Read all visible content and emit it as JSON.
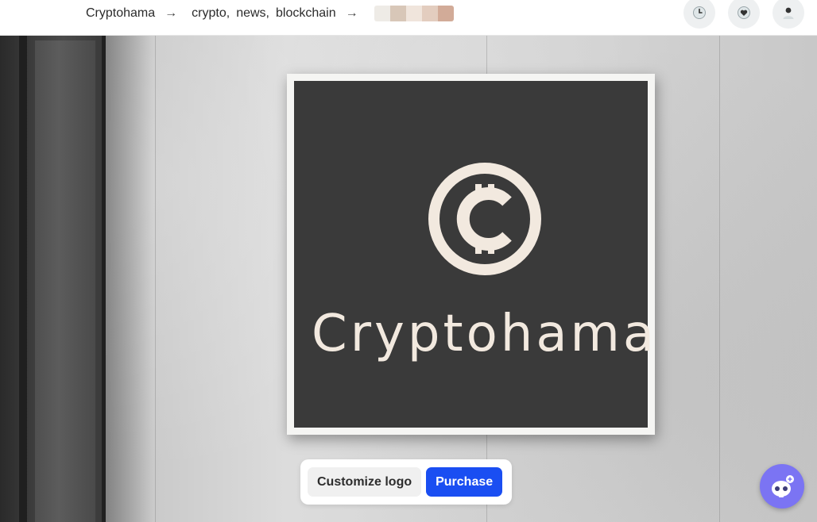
{
  "breadcrumb": {
    "brand": "Cryptohama",
    "tags": [
      {
        "label": "crypto",
        "sep": ","
      },
      {
        "label": "news",
        "sep": ","
      },
      {
        "label": "blockchain",
        "sep": ""
      }
    ],
    "arrow": "→",
    "palette": [
      "#eeebe6",
      "#d8c7b8",
      "#f0e5dc",
      "#e3cdbf",
      "#d2ab98"
    ]
  },
  "top_icons": [
    "history-icon",
    "heart-icon",
    "user-icon"
  ],
  "sign": {
    "brand_text": "Cryptohama",
    "logo_icon": "cent-coin-icon"
  },
  "actions": {
    "customize_label": "Customize logo",
    "purchase_label": "Purchase"
  },
  "assistant": {
    "icon": "robot-icon"
  },
  "colors": {
    "accent": "#1a4ef2",
    "board": "#3a3a3a",
    "logo_cream": "#f2e9df",
    "assistant": "#7b74f3"
  }
}
